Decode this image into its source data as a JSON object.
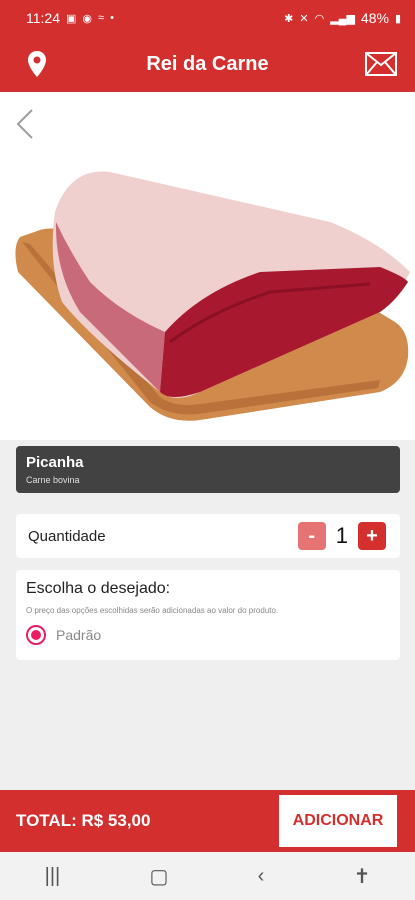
{
  "status": {
    "time": "11:24",
    "battery": "48%"
  },
  "header": {
    "title": "Rei da Carne",
    "icons": {
      "left": "location-pin-icon",
      "right": "mail-icon"
    }
  },
  "product": {
    "name": "Picanha",
    "category": "Carne bovina"
  },
  "quantity": {
    "label": "Quantidade",
    "minus": "-",
    "value": "1",
    "plus": "+"
  },
  "options": {
    "title": "Escolha o desejado:",
    "note": "O preço das opções escolhidas serão adicionadas ao valor do produto.",
    "items": [
      {
        "label": "Padrão",
        "selected": true
      }
    ]
  },
  "footer": {
    "total": "TOTAL: R$ 53,00",
    "add_label": "ADICIONAR"
  },
  "colors": {
    "primary": "#d32f2f",
    "accent": "#e91e63",
    "card_dark": "#424242"
  }
}
